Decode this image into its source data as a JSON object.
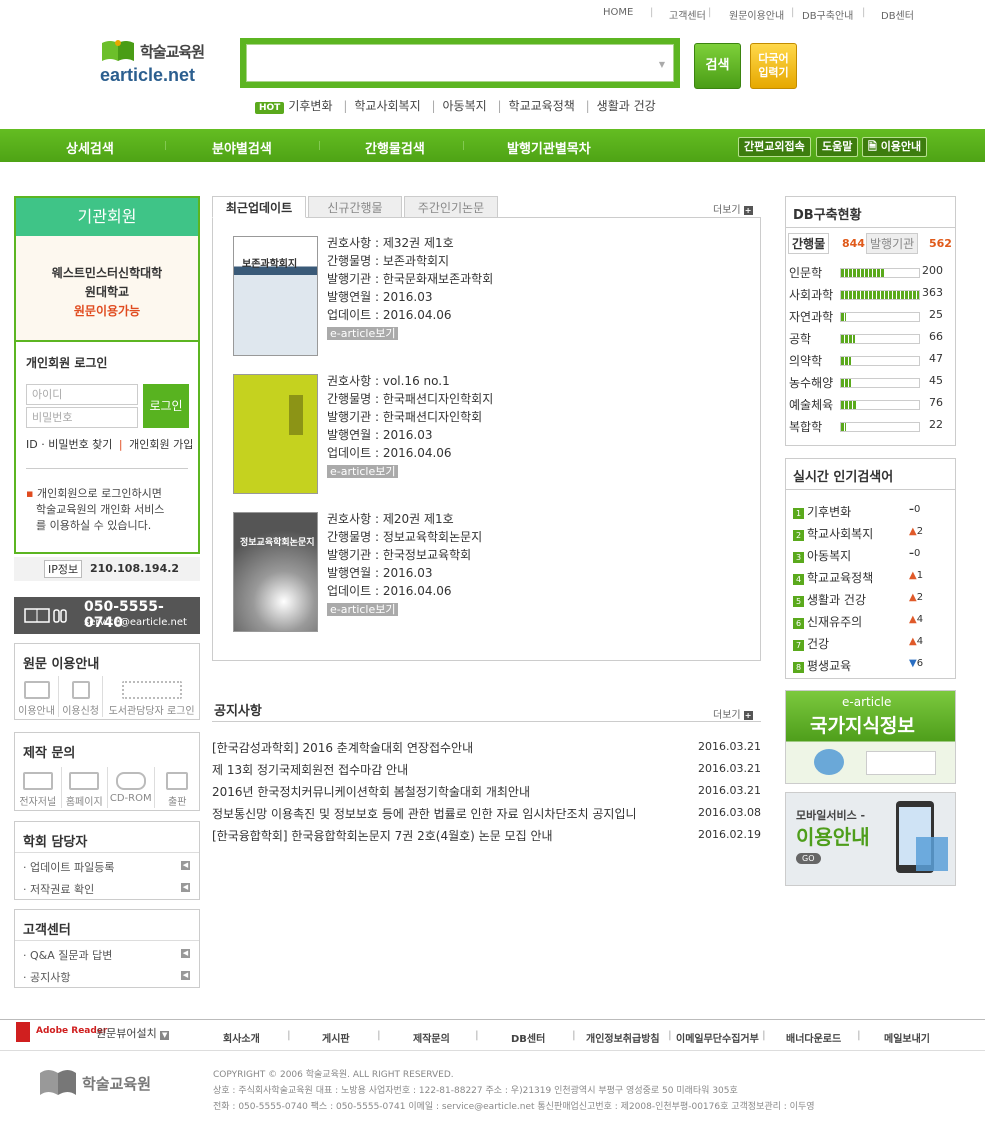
{
  "top_nav": [
    "HOME",
    "고객센터",
    "원문이용안내",
    "DB구축안내",
    "DB센터"
  ],
  "logo": {
    "ko": "학술교육원",
    "en": "earticle.net"
  },
  "search": {
    "button": "검색",
    "multi": [
      "다국어",
      "입력기"
    ]
  },
  "hot": {
    "badge": "HOT",
    "keywords": [
      "기후변화",
      "학교사회복지",
      "아동복지",
      "학교교육정책",
      "생활과 건강"
    ]
  },
  "main_menu": [
    "상세검색",
    "분야별검색",
    "간행물검색",
    "발행기관별목차"
  ],
  "sub_menu": [
    "간편교외접속",
    "도움말",
    "이용안내"
  ],
  "institution": {
    "title": "기관회원",
    "org_line1": "웨스트민스터신학대학",
    "org_line2": "원대학교",
    "status": "원문이용가능"
  },
  "login": {
    "title": "개인회원 로그인",
    "id_placeholder": "아이디",
    "pw_placeholder": "비밀번호",
    "button": "로그인",
    "find": "ID · 비밀번호 찾기",
    "join": "개인회원 가입",
    "note": [
      "개인회원으로 로그인하시면",
      "학술교육원의 개인화 서비스",
      "를 이용하실 수 있습니다."
    ]
  },
  "ip": {
    "label": "IP정보",
    "value": "210.108.194.2"
  },
  "contact": {
    "phone": "050-5555-0740",
    "email": "service@earticle.net"
  },
  "usage_guide": {
    "title": "원문 이용안내",
    "items": [
      "이용안내",
      "이용신청",
      "도서관담당자 로그인"
    ]
  },
  "production": {
    "title": "제작 문의",
    "items": [
      "전자저널",
      "홈페이지",
      "CD-ROM",
      "출판"
    ]
  },
  "society": {
    "title": "학회 담당자",
    "items": [
      "업데이트 파일등록",
      "저작권료 확인"
    ]
  },
  "support": {
    "title": "고객센터",
    "items": [
      "Q&A 질문과 답변",
      "공지사항"
    ]
  },
  "tabs": [
    "최근업데이트",
    "신규간행물",
    "주간인기논문"
  ],
  "more_label": "더보기",
  "labels": {
    "volume": "권호사항",
    "journal": "간행물명",
    "publisher": "발행기관",
    "pub_date": "발행연월",
    "updated": "업데이트",
    "ebutton": "e-article보기"
  },
  "updates": [
    {
      "volume": "제32권 제1호",
      "journal": "보존과학회지",
      "publisher": "한국문화재보존과학회",
      "pub_date": "2016.03",
      "updated": "2016.04.06",
      "cover_title": "보존과학회지"
    },
    {
      "volume": "vol.16 no.1",
      "journal": "한국패션디자인학회지",
      "publisher": "한국패션디자인학회",
      "pub_date": "2016.03",
      "updated": "2016.04.06",
      "cover_title": ""
    },
    {
      "volume": "제20권 제1호",
      "journal": "정보교육학회논문지",
      "publisher": "한국정보교육학회",
      "pub_date": "2016.03",
      "updated": "2016.04.06",
      "cover_title": "정보교육학회논문지"
    }
  ],
  "notice": {
    "title": "공지사항",
    "items": [
      {
        "text": "[한국감성과학회] 2016 춘계학술대회 연장접수안내",
        "date": "2016.03.21"
      },
      {
        "text": "제 13회 정기국제회원전 접수마감 안내",
        "date": "2016.03.21"
      },
      {
        "text": "2016년 한국정치커뮤니케이션학회 봄철정기학술대회 개최안내",
        "date": "2016.03.21"
      },
      {
        "text": "정보통신망 이용촉진 및 정보보호 등에 관한 법률로 인한 자료 임시차단조치 공지입니",
        "date": "2016.03.08"
      },
      {
        "text": "[한국융합학회] 한국융합학회논문지 7권 2호(4월호) 논문 모집 안내",
        "date": "2016.02.19"
      }
    ]
  },
  "db_status": {
    "title": "DB구축현황",
    "tab1": "간행물",
    "count1": "844",
    "tab2": "발행기관",
    "count2": "562",
    "rows": [
      {
        "field": "인문학",
        "count": 200
      },
      {
        "field": "사회과학",
        "count": 363
      },
      {
        "field": "자연과학",
        "count": 25
      },
      {
        "field": "공학",
        "count": 66
      },
      {
        "field": "의약학",
        "count": 47
      },
      {
        "field": "농수해양",
        "count": 45
      },
      {
        "field": "예술체육",
        "count": 76
      },
      {
        "field": "복합학",
        "count": 22
      }
    ]
  },
  "popular": {
    "title": "실시간 인기검색어",
    "items": [
      {
        "rank": "1",
        "kw": "기후변화",
        "dir": "same",
        "chg": "0"
      },
      {
        "rank": "2",
        "kw": "학교사회복지",
        "dir": "up",
        "chg": "2"
      },
      {
        "rank": "3",
        "kw": "아동복지",
        "dir": "same",
        "chg": "0"
      },
      {
        "rank": "4",
        "kw": "학교교육정책",
        "dir": "up",
        "chg": "1"
      },
      {
        "rank": "5",
        "kw": "생활과 건강",
        "dir": "up",
        "chg": "2"
      },
      {
        "rank": "6",
        "kw": "신재유주의",
        "dir": "up",
        "chg": "4"
      },
      {
        "rank": "7",
        "kw": "건강",
        "dir": "up",
        "chg": "4"
      },
      {
        "rank": "8",
        "kw": "평생교육",
        "dir": "down",
        "chg": "6"
      }
    ]
  },
  "banner1": {
    "top": "e-article",
    "main": "국가지식정보"
  },
  "banner2": {
    "top": "모바일서비스 -",
    "main": "이용안내",
    "go": "GO"
  },
  "footer": {
    "adobe": "Adobe Reader",
    "viewer": "원문뷰어설치",
    "links": [
      "회사소개",
      "게시판",
      "제작문의",
      "DB센터",
      "개인정보취급방침",
      "이메일무단수집거부",
      "배너다운로드",
      "메일보내기"
    ],
    "logo": "학술교육원",
    "copyright": "COPYRIGHT © 2006 학술교육원. ALL RIGHT RESERVED.",
    "address": "상호 : 주식회사학술교육원 대표 : 노방용 사업자번호 : 122-81-88227 주소 : 우)21319 인천광역시 부평구 영성중로 50 미래타워 305호",
    "tel": "전화 : 050-5555-0740 팩스 : 050-5555-0741 이메일 : service@earticle.net 통신판매업신고번호 : 제2008-인천부평-00176호 고객정보관리 : 이두영"
  }
}
